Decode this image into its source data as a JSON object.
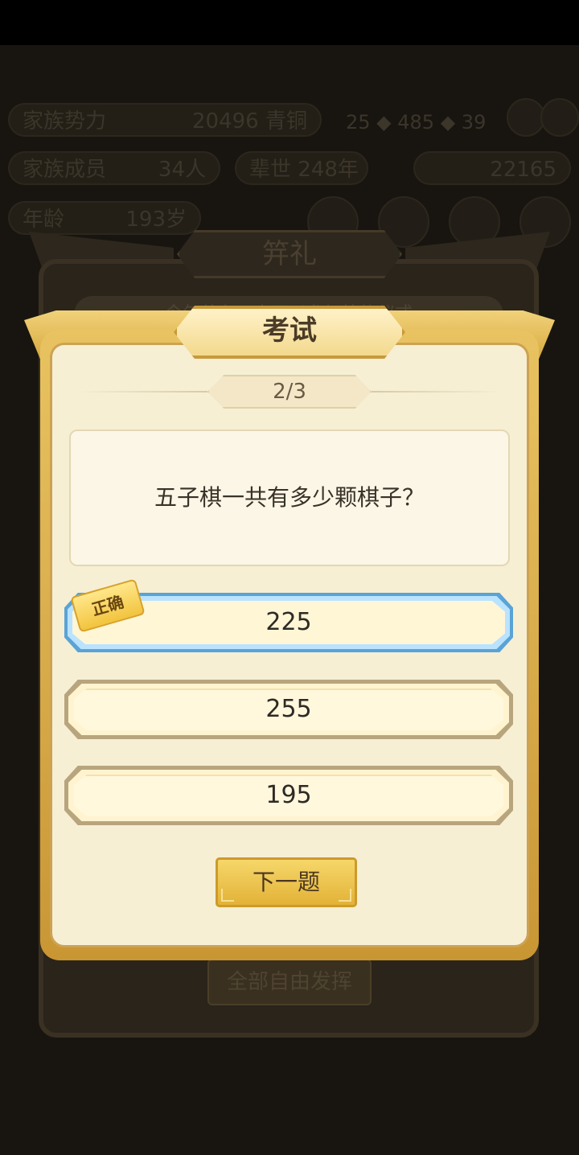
{
  "background": {
    "family_power_label": "家族势力",
    "family_power_value": "20496",
    "family_power_tag": "青铜",
    "tool_counts": [
      "25",
      "485",
      "39"
    ],
    "members_label": "家族成员",
    "members_value": "34人",
    "generation_label": "辈世",
    "generation_value": "248年",
    "gold_value": "22165",
    "age_label": "年龄",
    "age_value": "193岁",
    "panel_title": "笄礼",
    "panel_subtitle": "今年共有…人可以参加笄礼仪式",
    "bottom_button": "全部自由发挥"
  },
  "dialog": {
    "title": "考试",
    "progress": "2/3",
    "question": "五子棋一共有多少颗棋子？",
    "options": [
      {
        "label": "225",
        "selected": true
      },
      {
        "label": "255",
        "selected": false
      },
      {
        "label": "195",
        "selected": false
      }
    ],
    "correct_badge": "正确",
    "next_button": "下一题"
  },
  "colors": {
    "gold_frame": "#d8a93f",
    "parchment": "#f6efd4",
    "selected_blue": "#5aa3d6"
  }
}
